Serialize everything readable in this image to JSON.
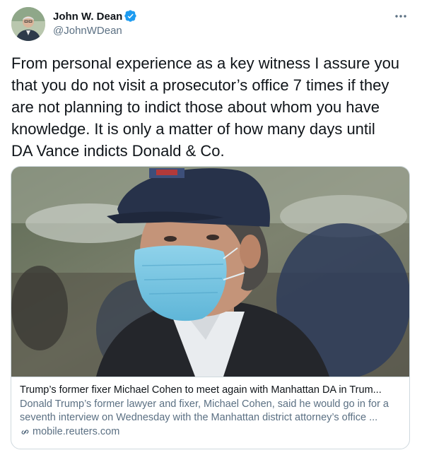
{
  "author": {
    "display_name": "John W. Dean",
    "handle": "@JohnWDean",
    "verified": true,
    "verified_color": "#1d9bf0"
  },
  "tweet": {
    "text": "From personal experience as a key witness I assure you\nthat you do not visit a prosecutor’s office 7 times if they\nare not planning to indict those about whom you have\nknowledge. It is only a matter of how many days until\nDA Vance indicts Donald & Co."
  },
  "link_card": {
    "title": "Trump’s former fixer Michael Cohen to meet again with Manhattan DA in Trum...",
    "description": "Donald Trump’s former lawyer and fixer, Michael Cohen, said he would go in for a seventh interview on Wednesday with the Manhattan district attorney’s office ...",
    "domain": "mobile.reuters.com"
  },
  "icons": {
    "more": "more-options-icon",
    "verified": "verified-badge-icon",
    "link": "link-icon"
  },
  "colors": {
    "text_primary": "#0f1419",
    "text_secondary": "#5b7083",
    "border": "#cfd9de"
  }
}
